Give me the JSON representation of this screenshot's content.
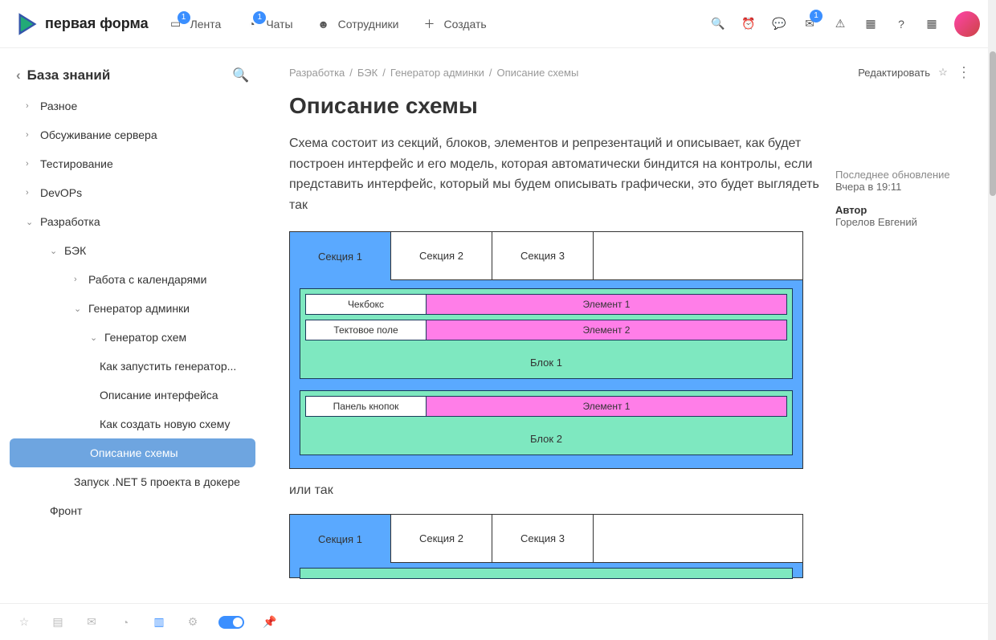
{
  "topnav": {
    "brand": "первая форма",
    "items": [
      {
        "label": "Лента",
        "badge": "1"
      },
      {
        "label": "Чаты",
        "badge": "1"
      },
      {
        "label": "Сотрудники"
      },
      {
        "label": "Создать"
      }
    ],
    "mail_badge": "1"
  },
  "sidebar": {
    "title": "База знаний",
    "tree": {
      "misc": "Разное",
      "server": "Обсуживание сервера",
      "testing": "Тестирование",
      "devops": "DevOPs",
      "dev": "Разработка",
      "back": "БЭК",
      "calendars": "Работа с календарями",
      "gen_admin": "Генератор админки",
      "gen_schemes": "Генератор схем",
      "how_run": "Как запустить генератор...",
      "desc_ui": "Описание интерфейса",
      "how_create": "Как создать новую схему",
      "desc_schema": "Описание схемы",
      "docker": "Запуск .NET 5 проекта в докере",
      "front": "Фронт"
    }
  },
  "breadcrumb": {
    "p0": "Разработка",
    "p1": "БЭК",
    "p2": "Генератор админки",
    "p3": "Описание схемы",
    "edit": "Редактировать"
  },
  "page": {
    "title": "Описание схемы",
    "description": "Схема состоит из секций, блоков, элементов и репрезентаций и описывает, как будет построен интерфейс и его модель, которая автоматически биндится на контролы, если представить интерфейс, который мы будем описывать графически, это будет выглядеть так",
    "or_text": "или так"
  },
  "meta": {
    "updated_label": "Последнее обновление",
    "updated_value": "Вчера в 19:11",
    "author_label": "Автор",
    "author_value": "Горелов Евгений"
  },
  "diagram1": {
    "sections": [
      "Секция 1",
      "Секция 2",
      "Секция 3"
    ],
    "block1": {
      "rows": [
        {
          "left": "Чекбокс",
          "right": "Элемент 1"
        },
        {
          "left": "Тектовое поле",
          "right": "Элемент 2"
        }
      ],
      "label": "Блок 1"
    },
    "block2": {
      "rows": [
        {
          "left": "Панель кнопок",
          "right": "Элемент 1"
        }
      ],
      "label": "Блок 2"
    }
  },
  "diagram2": {
    "sections": [
      "Секция 1",
      "Секция 2",
      "Секция 3"
    ]
  }
}
